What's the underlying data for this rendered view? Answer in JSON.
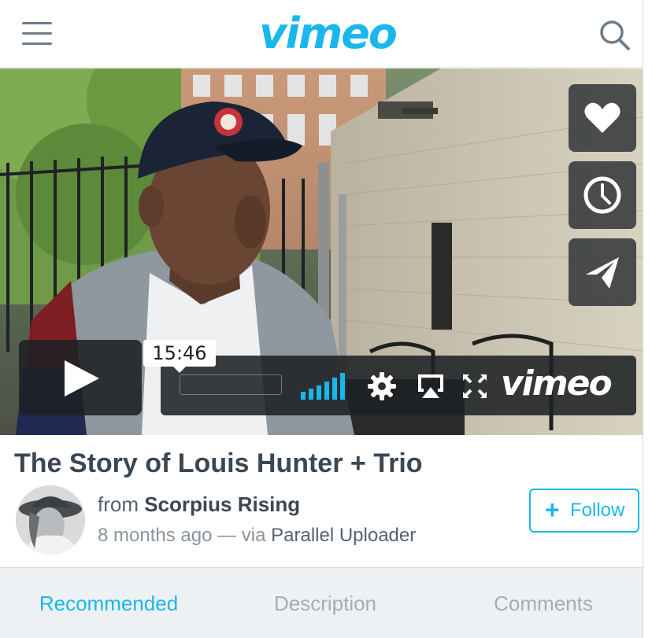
{
  "header": {
    "logo_text": "vimeo",
    "menu_icon": "hamburger-menu-icon",
    "search_icon": "search-icon",
    "brand_color": "#1ab7ea"
  },
  "video": {
    "side_actions": [
      {
        "name": "like",
        "icon": "heart-icon"
      },
      {
        "name": "watch-later",
        "icon": "clock-icon"
      },
      {
        "name": "share",
        "icon": "paper-plane-icon"
      }
    ],
    "player": {
      "duration": "15:46",
      "player_logo": "vimeo",
      "volume_level": 0.8,
      "progress": 0.0,
      "icons": [
        "play-icon",
        "volume-bars-icon",
        "settings-gear-icon",
        "airplay-icon",
        "fullscreen-icon"
      ]
    }
  },
  "info": {
    "title": "The Story of Louis Hunter + Trio",
    "from_prefix": "from",
    "author": "Scorpius Rising",
    "time_ago": "8 months ago",
    "separator": " — via ",
    "via_app": "Parallel Uploader",
    "follow_label": "Follow",
    "follow_icon": "plus-icon"
  },
  "tabs": [
    {
      "label": "Recommended",
      "active": true
    },
    {
      "label": "Description",
      "active": false
    },
    {
      "label": "Comments",
      "active": false
    }
  ],
  "colors": {
    "accent": "#1ab7ea",
    "title_text": "#3b4752",
    "muted_text": "#8a959d",
    "tab_bar": "#eef1f4"
  }
}
